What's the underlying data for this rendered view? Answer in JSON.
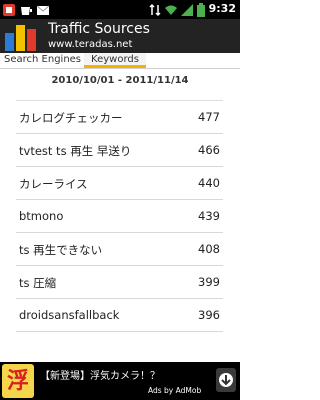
{
  "status_bar": {
    "time": "9:32",
    "icons": [
      "notification-icon",
      "drink-cup-icon",
      "email-icon",
      "mobile-network-icon",
      "wifi-icon",
      "signal-icon",
      "battery-icon"
    ]
  },
  "app": {
    "title": "Traffic Sources",
    "subtitle": "www.teradas.net"
  },
  "tabs": [
    {
      "label": "Search Engines",
      "selected": false
    },
    {
      "label": "Keywords",
      "selected": true
    }
  ],
  "date_range": "2010/10/01 - 2011/11/14",
  "keywords": [
    {
      "keyword": "カレログチェッカー",
      "count": "477"
    },
    {
      "keyword": "tvtest ts 再生 早送り",
      "count": "466"
    },
    {
      "keyword": "カレーライス",
      "count": "440"
    },
    {
      "keyword": "btmono",
      "count": "439"
    },
    {
      "keyword": "ts 再生できない",
      "count": "408"
    },
    {
      "keyword": "ts 圧縮",
      "count": "399"
    },
    {
      "keyword": "droidsansfallback",
      "count": "396"
    }
  ],
  "ad": {
    "logo_char": "浮",
    "text": "【新登場】浮気カメラ！？",
    "by": "Ads by AdMob"
  },
  "colors": {
    "header_bg": "#232323",
    "tab_highlight": "#f2b200",
    "ad_bg": "#000000"
  }
}
